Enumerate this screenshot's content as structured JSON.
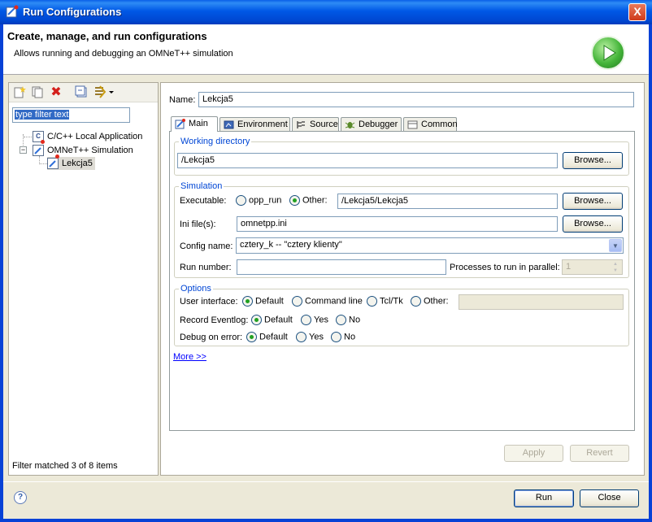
{
  "window": {
    "title": "Run Configurations",
    "close_label": "X"
  },
  "header": {
    "title": "Create, manage, and run configurations",
    "description": "Allows running and debugging an OMNeT++ simulation"
  },
  "left": {
    "filter_placeholder": "type filter text",
    "tree": [
      {
        "label": "C/C++ Local Application",
        "icon": "c-icon"
      },
      {
        "label": "OMNeT++ Simulation",
        "icon": "omnet-icon",
        "expanded": true
      },
      {
        "label": "Lekcja5",
        "icon": "config-icon",
        "selected": true
      }
    ],
    "status": "Filter matched 3 of 8 items"
  },
  "config": {
    "name_label": "Name:",
    "name_value": "Lekcja5",
    "tabs": [
      {
        "label": "Main",
        "icon": "main-tab-icon",
        "active": true
      },
      {
        "label": "Environment",
        "icon": "environment-icon"
      },
      {
        "label": "Source",
        "icon": "source-icon"
      },
      {
        "label": "Debugger",
        "icon": "debugger-icon"
      },
      {
        "label": "Common",
        "icon": "common-icon"
      }
    ],
    "working_dir": {
      "group_label": "Working directory",
      "value": "/Lekcja5",
      "browse_label": "Browse..."
    },
    "simulation": {
      "group_label": "Simulation",
      "executable_label": "Executable:",
      "opt_opp_run": "opp_run",
      "opt_other": "Other:",
      "executable_value": "/Lekcja5/Lekcja5",
      "browse_label": "Browse...",
      "ini_label": "Ini file(s):",
      "ini_value": "omnetpp.ini",
      "browse_label_2": "Browse...",
      "config_label": "Config name:",
      "config_value": "cztery_k -- \"cztery klienty\"",
      "run_label": "Run number:",
      "run_value": "",
      "parallel_label": "Processes to run in parallel:",
      "parallel_value": "1"
    },
    "options": {
      "group_label": "Options",
      "ui_label": "User interface:",
      "ui_default": "Default",
      "ui_cmdline": "Command line",
      "ui_tcltk": "Tcl/Tk",
      "ui_other": "Other:",
      "ui_other_value": "",
      "eventlog_label": "Record Eventlog:",
      "ev_default": "Default",
      "ev_yes": "Yes",
      "ev_no": "No",
      "debug_label": "Debug on error:",
      "db_default": "Default",
      "db_yes": "Yes",
      "db_no": "No"
    },
    "more_link": "More >>",
    "apply_label": "Apply",
    "revert_label": "Revert"
  },
  "footer": {
    "help_label": "?",
    "run_label": "Run",
    "close_label": "Close"
  },
  "colors": {
    "titlebar": "#0058e6",
    "group_label": "#0046d5",
    "selection": "#316ac5"
  }
}
